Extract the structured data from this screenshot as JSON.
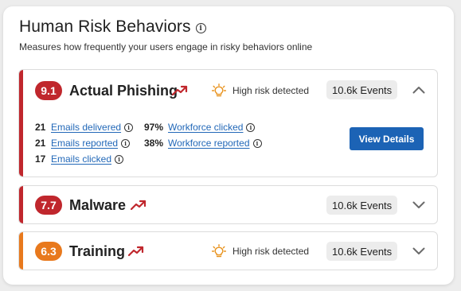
{
  "header": {
    "title": "Human Risk Behaviors",
    "info_glyph": "i",
    "subtitle": "Measures how frequently your users engage in risky behaviors online"
  },
  "behaviors": [
    {
      "score": "9.1",
      "name": "Actual Phishing",
      "score_color": "#c0272d",
      "risk_label": "High risk detected",
      "events": "10.6k Events",
      "expanded": true,
      "metrics_left": [
        {
          "value": "21",
          "label": "Emails delivered"
        },
        {
          "value": "21",
          "label": "Emails reported"
        },
        {
          "value": "17",
          "label": "Emails clicked"
        }
      ],
      "metrics_right": [
        {
          "value": "97%",
          "label": "Workforce clicked"
        },
        {
          "value": "38%",
          "label": "Workforce reported"
        }
      ],
      "button": "View Details"
    },
    {
      "score": "7.7",
      "name": "Malware",
      "score_color": "#c0272d",
      "events": "10.6k Events",
      "expanded": false
    },
    {
      "score": "6.3",
      "name": "Training",
      "score_color": "#e8791d",
      "risk_label": "High risk detected",
      "events": "10.6k Events",
      "expanded": false
    }
  ],
  "colors": {
    "critical": "#c0272d",
    "warning": "#e8791d",
    "trend": "#c0272d",
    "link": "#2268b8",
    "button": "#1c63b5",
    "bulb": "#e8921d"
  },
  "icons": {
    "info": "info-circle-icon",
    "trend": "trend-up-icon",
    "risk": "lightbulb-icon",
    "collapse": "chevron-up-icon",
    "expand": "chevron-down-icon"
  }
}
